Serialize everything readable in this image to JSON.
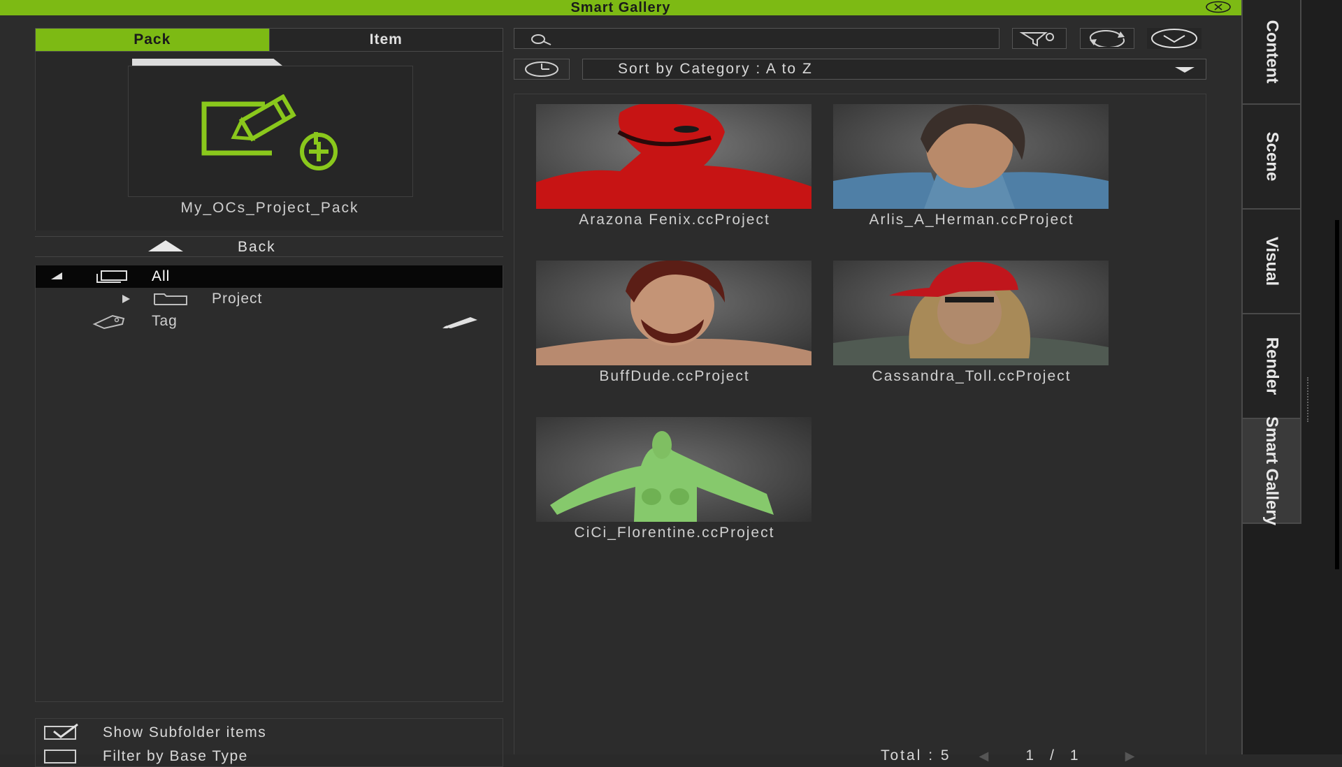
{
  "window": {
    "title": "Smart Gallery"
  },
  "left": {
    "tabs": [
      {
        "label": "Pack",
        "active": true
      },
      {
        "label": "Item",
        "active": false
      }
    ],
    "pack": {
      "name": "My_OCs_Project_Pack"
    },
    "back_label": "Back",
    "tree": [
      {
        "label": "All",
        "icon": "screen-icon",
        "selected": true
      },
      {
        "label": "Project",
        "icon": "folder-icon",
        "selected": false
      },
      {
        "label": "Tag",
        "icon": "tag-icon",
        "selected": false
      }
    ],
    "options": [
      {
        "label": "Show Subfolder items",
        "checked": true
      },
      {
        "label": "Filter by Base Type",
        "checked": false
      }
    ]
  },
  "right": {
    "search": {
      "value": "",
      "placeholder": ""
    },
    "sort": {
      "label": "Sort by Category : A to Z"
    },
    "items": [
      {
        "label": "Arazona Fenix.ccProject"
      },
      {
        "label": "Arlis_A_Herman.ccProject"
      },
      {
        "label": "BuffDude.ccProject"
      },
      {
        "label": "Cassandra_Toll.ccProject"
      },
      {
        "label": "CiCi_Florentine.ccProject"
      }
    ],
    "footer": {
      "total_label": "Total : 5",
      "page": "1",
      "separator": "/",
      "pages": "1"
    }
  },
  "sidebar": {
    "tabs": [
      {
        "label": "Content",
        "active": false
      },
      {
        "label": "Scene",
        "active": false
      },
      {
        "label": "Visual",
        "active": false
      },
      {
        "label": "Render",
        "active": false
      },
      {
        "label": "Smart Gallery",
        "active": true
      }
    ]
  },
  "colors": {
    "accent": "#7dba14",
    "background": "#2c2c2c",
    "selected_row": "#070707"
  }
}
